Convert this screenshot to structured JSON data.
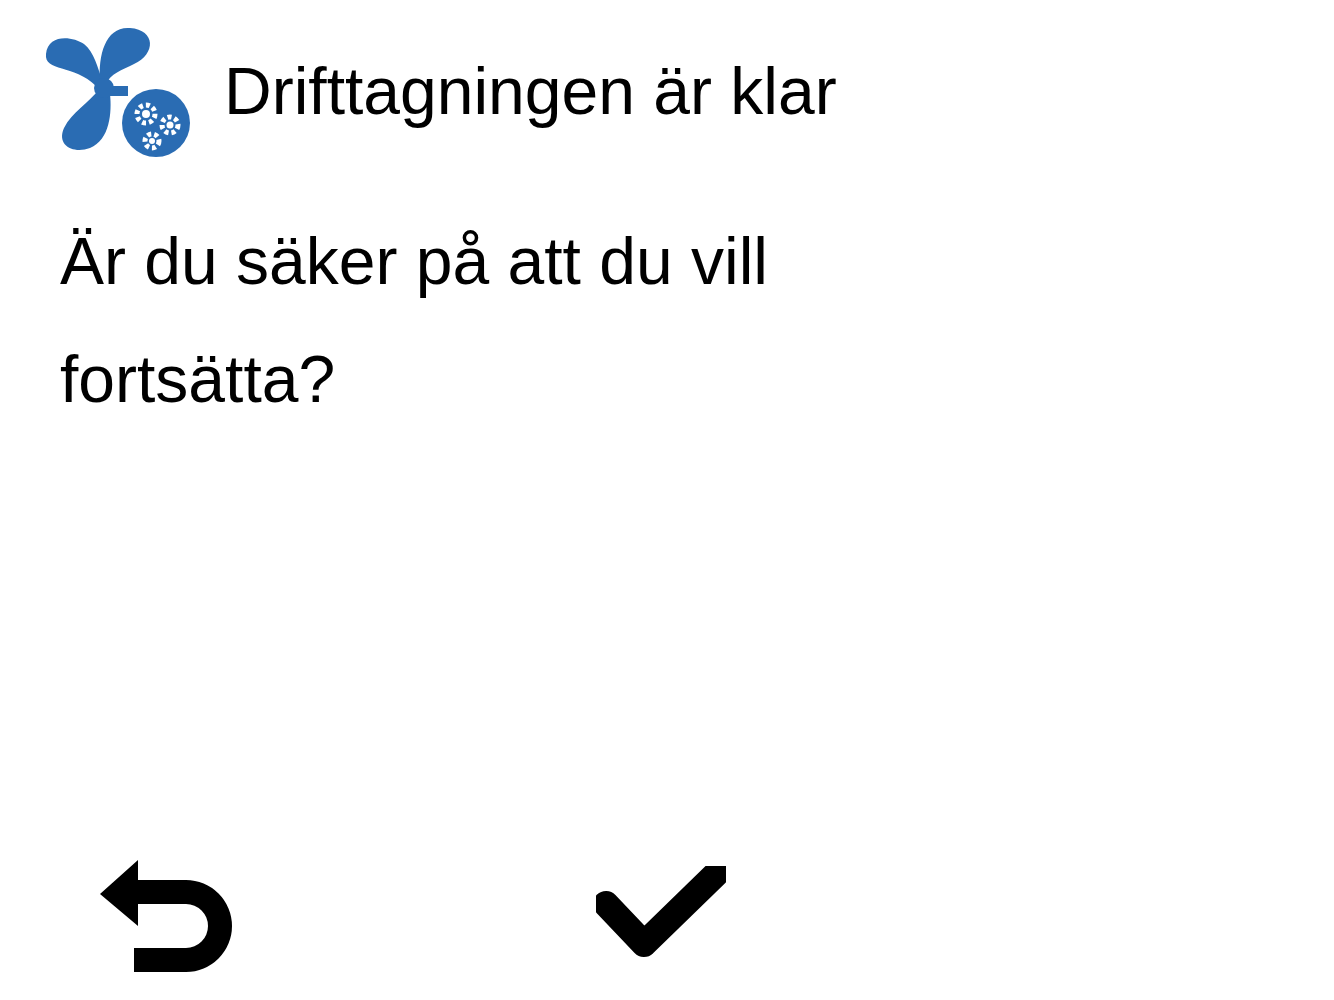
{
  "header": {
    "title": "Drifttagningen är klar"
  },
  "message": "Är du säker på att du vill fortsätta?",
  "buttons": [
    {
      "kind": "back"
    },
    {
      "kind": "confirm"
    }
  ]
}
